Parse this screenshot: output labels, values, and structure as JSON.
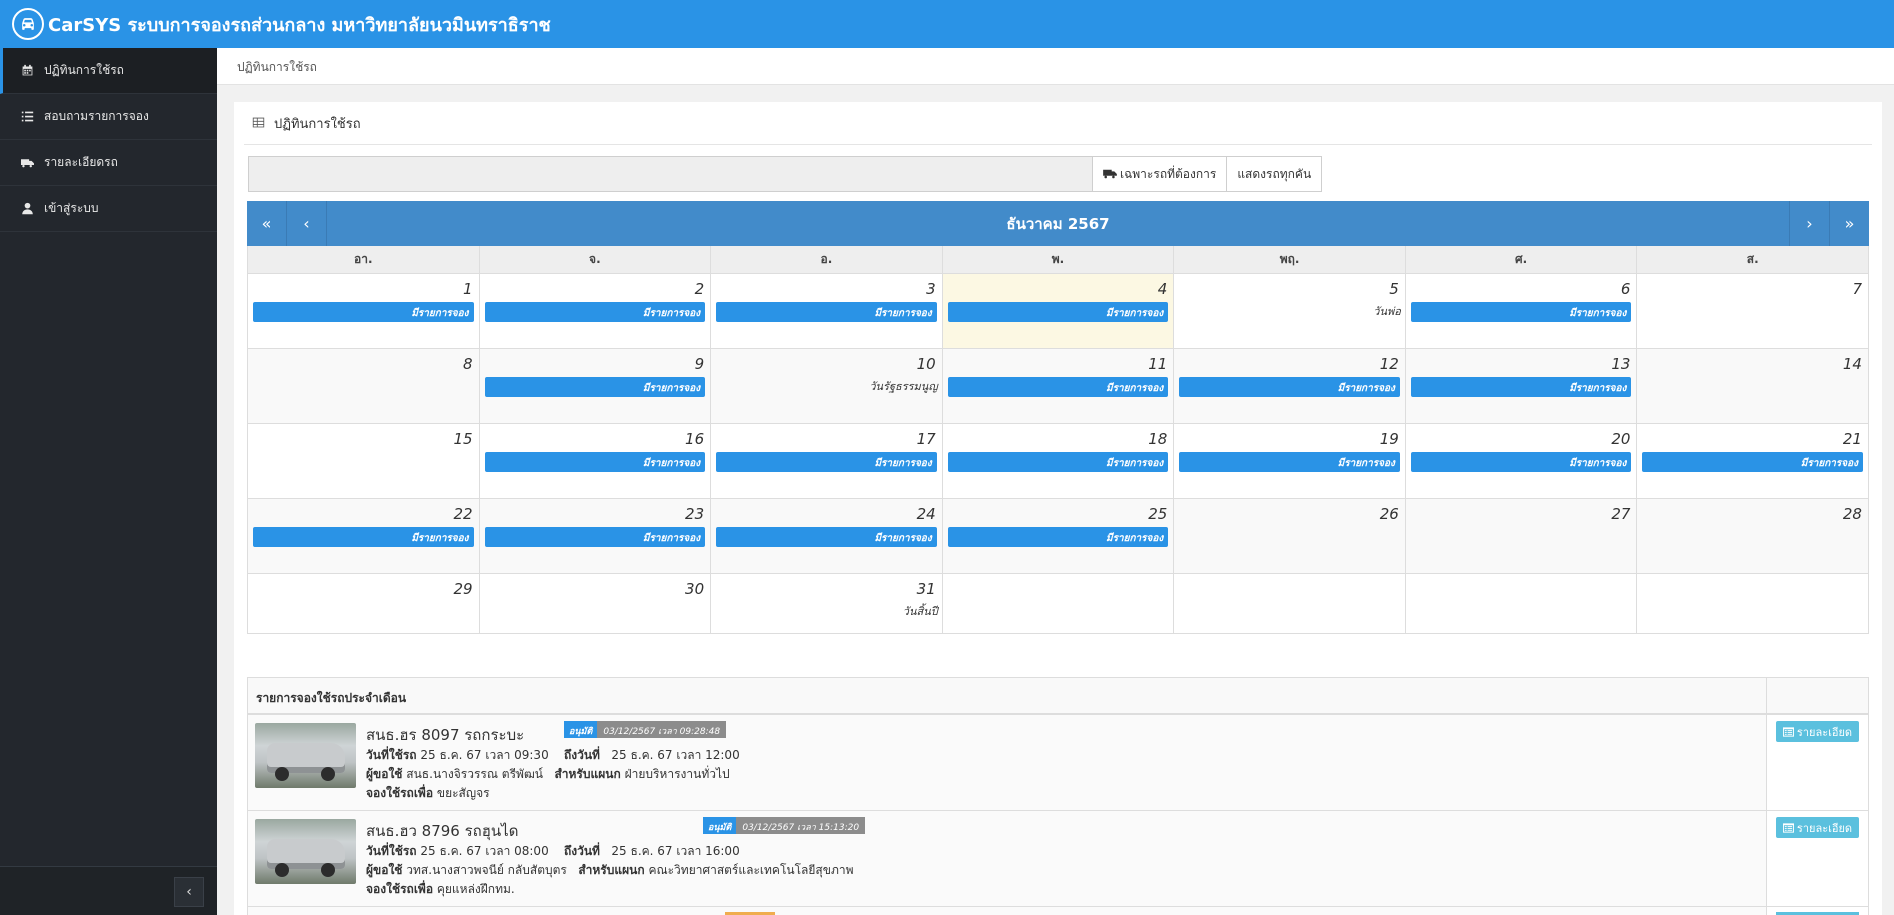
{
  "header": {
    "title": "CarSYS ระบบการจองรถส่วนกลาง มหาวิทยาลัยนวมินทราธิราช"
  },
  "sidebar": {
    "items": [
      {
        "label": "ปฏิทินการใช้รถ",
        "icon": "calendar-icon"
      },
      {
        "label": "สอบถามรายการจอง",
        "icon": "list-icon"
      },
      {
        "label": "รายละเอียดรถ",
        "icon": "truck-icon"
      },
      {
        "label": "เข้าสู่ระบบ",
        "icon": "user-icon"
      }
    ],
    "collapse_icon": "‹"
  },
  "breadcrumb": "ปฏิทินการใช้รถ",
  "card": {
    "title": "ปฏิทินการใช้รถ"
  },
  "filter": {
    "input_value": "",
    "specific_label": "เฉพาะรถที่ต้องการ",
    "all_label": "แสดงรถทุกคัน"
  },
  "calendar": {
    "month_label": "ธันวาคม 2567",
    "nav": {
      "prev_year": "«",
      "prev": "‹",
      "next": "›",
      "next_year": "»"
    },
    "weekdays": [
      "อา.",
      "จ.",
      "อ.",
      "พ.",
      "พฤ.",
      "ศ.",
      "ส."
    ],
    "booking_label": "มีรายการจอง",
    "weeks": [
      [
        {
          "d": "1",
          "b": true
        },
        {
          "d": "2",
          "b": true
        },
        {
          "d": "3",
          "b": true
        },
        {
          "d": "4",
          "b": true,
          "today": true
        },
        {
          "d": "5",
          "h": "วันพ่อ"
        },
        {
          "d": "6",
          "b": true
        },
        {
          "d": "7"
        }
      ],
      [
        {
          "d": "8"
        },
        {
          "d": "9",
          "b": true
        },
        {
          "d": "10",
          "h": "วันรัฐธรรมนูญ"
        },
        {
          "d": "11",
          "b": true
        },
        {
          "d": "12",
          "b": true
        },
        {
          "d": "13",
          "b": true
        },
        {
          "d": "14"
        }
      ],
      [
        {
          "d": "15"
        },
        {
          "d": "16",
          "b": true
        },
        {
          "d": "17",
          "b": true
        },
        {
          "d": "18",
          "b": true
        },
        {
          "d": "19",
          "b": true
        },
        {
          "d": "20",
          "b": true
        },
        {
          "d": "21",
          "b": true
        }
      ],
      [
        {
          "d": "22",
          "b": true
        },
        {
          "d": "23",
          "b": true
        },
        {
          "d": "24",
          "b": true
        },
        {
          "d": "25",
          "b": true
        },
        {
          "d": "26"
        },
        {
          "d": "27"
        },
        {
          "d": "28"
        }
      ],
      [
        {
          "d": "29"
        },
        {
          "d": "30"
        },
        {
          "d": "31",
          "h": "วันสิ้นปี"
        },
        {
          "d": ""
        },
        {
          "d": ""
        },
        {
          "d": ""
        },
        {
          "d": ""
        }
      ]
    ]
  },
  "bookings": {
    "title": "รายการจองใช้รถประจำเดือน",
    "detail_label": "รายละเอียด",
    "labels": {
      "use_date": "วันที่ใช้รถ",
      "to_date": "ถึงวันที่",
      "requester": "ผู้ขอใช้",
      "dept": "สำหรับแผนก",
      "purpose": "จองใช้รถเพื่อ"
    },
    "items": [
      {
        "vehicle": "สนธ.ฮร 8097 รถกระบะ",
        "status": "อนุมัติ",
        "timestamp": "03/12/2567 เวลา 09:28:48",
        "use_date": "25 ธ.ค. 67 เวลา 09:30",
        "to_date": "25 ธ.ค. 67 เวลา 12:00",
        "requester": "สนธ.นางจิรวรรณ ตรีพัฒน์",
        "dept": "ฝ่ายบริหารงานทั่วไป",
        "purpose": "ขยะสัญจร"
      },
      {
        "vehicle": "สนธ.ฮว 8796 รถฮุนได",
        "status": "อนุมัติ",
        "timestamp": "03/12/2567 เวลา 15:13:20",
        "use_date": "25 ธ.ค. 67 เวลา 08:00",
        "to_date": "25 ธ.ค. 67 เวลา 16:00",
        "requester": "วทส.นางสาวพจนีย์ กลับสัตบุตร",
        "dept": "คณะวิทยาศาสตร์และเทคโนโลยีสุขภาพ",
        "purpose": "คุยแหล่งฝึกทม."
      }
    ]
  },
  "colors": {
    "primary": "#2a93e6",
    "nav": "#428bca",
    "sidebar": "#23272d",
    "today": "#fcf8e3",
    "info": "#5bc0de",
    "warning": "#f0ad4e"
  }
}
